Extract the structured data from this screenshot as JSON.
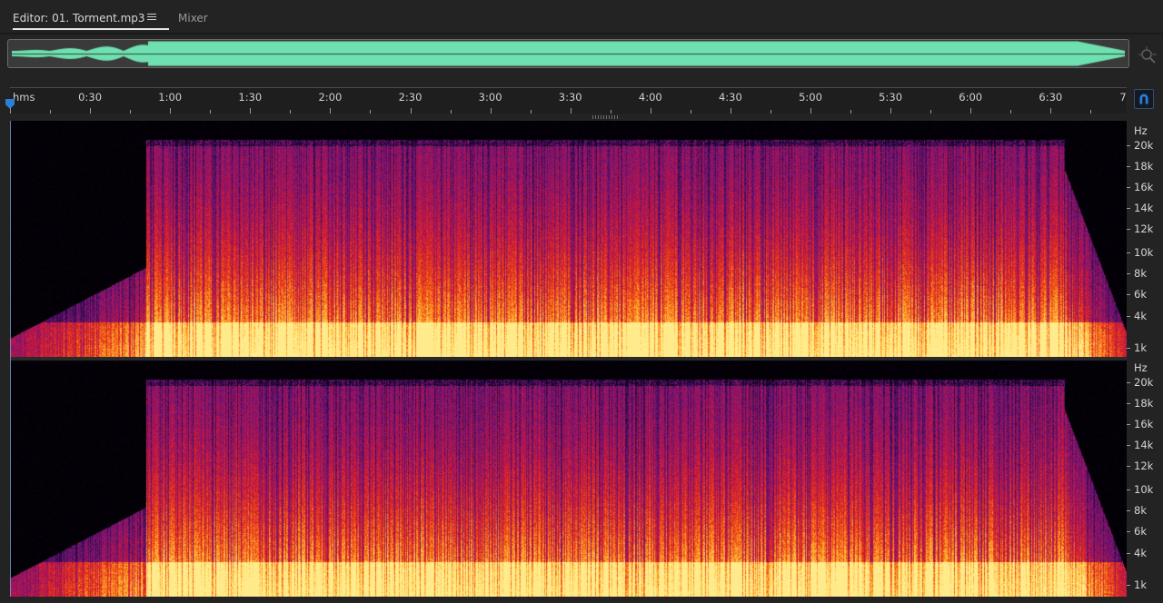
{
  "tabs": {
    "editor_label": "Editor: 01. Torment.mp3",
    "mixer_label": "Mixer"
  },
  "ruler": {
    "unit_label": "hms",
    "labels": [
      "0:30",
      "1:00",
      "1:30",
      "2:00",
      "2:30",
      "3:00",
      "3:30",
      "4:00",
      "4:30",
      "5:00",
      "5:30",
      "6:00",
      "6:30",
      "7"
    ]
  },
  "frequency_axis": {
    "unit": "Hz",
    "labels": [
      "20k",
      "18k",
      "16k",
      "14k",
      "12k",
      "10k",
      "8k",
      "6k",
      "4k",
      "1k"
    ]
  },
  "colors": {
    "overview_waveform": "#6fe0b0",
    "accent": "#2d7fd6"
  },
  "icons": {
    "tab_menu": "hamburger-icon",
    "zoom": "zoom-navigator-icon",
    "snap": "magnet-icon",
    "playhead": "playhead-marker-icon"
  }
}
